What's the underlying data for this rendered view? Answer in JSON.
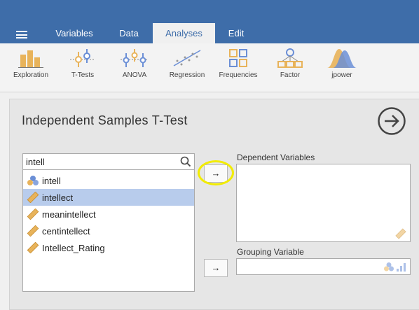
{
  "menu": {
    "tabs": [
      {
        "label": "Variables"
      },
      {
        "label": "Data"
      },
      {
        "label": "Analyses",
        "active": true
      },
      {
        "label": "Edit"
      }
    ]
  },
  "ribbon": {
    "buttons": [
      {
        "label": "Exploration",
        "icon": "exploration-icon"
      },
      {
        "label": "T-Tests",
        "icon": "ttests-icon"
      },
      {
        "label": "ANOVA",
        "icon": "anova-icon"
      },
      {
        "label": "Regression",
        "icon": "regression-icon"
      },
      {
        "label": "Frequencies",
        "icon": "frequencies-icon"
      },
      {
        "label": "Factor",
        "icon": "factor-icon"
      },
      {
        "label": "jpower",
        "icon": "jpower-icon"
      }
    ]
  },
  "analysis": {
    "title": "Independent Samples T-Test"
  },
  "search": {
    "value": "intell"
  },
  "variables": [
    {
      "name": "intell",
      "type": "nominal",
      "selected": false
    },
    {
      "name": "intellect",
      "type": "continuous",
      "selected": true
    },
    {
      "name": "meanintellect",
      "type": "continuous",
      "selected": false
    },
    {
      "name": "centintellect",
      "type": "continuous",
      "selected": false
    },
    {
      "name": "Intellect_Rating",
      "type": "continuous",
      "selected": false
    }
  ],
  "targets": {
    "dependent_label": "Dependent Variables",
    "grouping_label": "Grouping Variable",
    "move_symbol": "→"
  },
  "colors": {
    "header": "#3e6da9",
    "selected_row": "#b8ccec",
    "highlight": "#f2ec00",
    "continuous_icon": "#e8b35a",
    "nominal_icon": "#6b8fd6"
  }
}
